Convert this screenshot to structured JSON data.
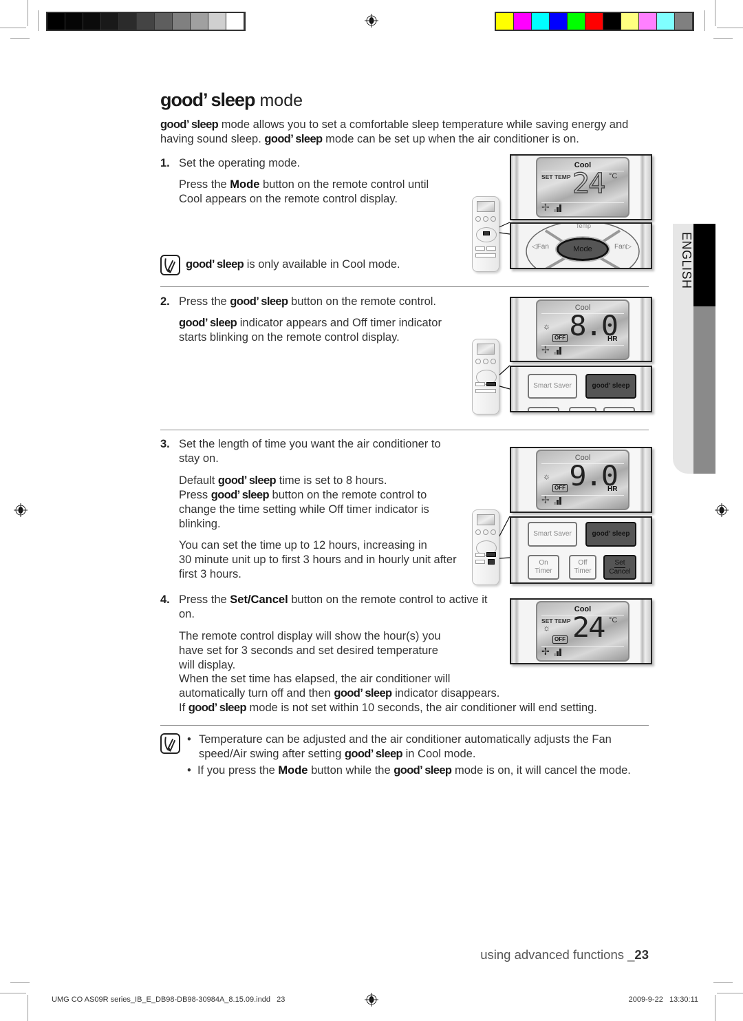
{
  "print_marks": {
    "gray_swatches": [
      "#000000",
      "#050505",
      "#0b0b0b",
      "#191919",
      "#2b2b2b",
      "#444444",
      "#5e5e5e",
      "#808080",
      "#a0a0a0",
      "#d0d0d0",
      "#ffffff"
    ],
    "color_swatches": [
      "#ffff00",
      "#ff00ff",
      "#00ffff",
      "#0000ff",
      "#00ff00",
      "#ff0000",
      "#000000",
      "#ffff80",
      "#ff80ff",
      "#80ffff",
      "#808080"
    ]
  },
  "side_tab": {
    "label": "ENGLISH"
  },
  "title": {
    "brand": "good’ sleep",
    "rest": " mode"
  },
  "intro": [
    [
      {
        "t": "good’ sleep",
        "s": "brand"
      },
      {
        "t": " mode allows you to set a comfortable sleep temperature while saving energy and"
      }
    ],
    [
      {
        "t": "having sound sleep. "
      },
      {
        "t": "good’ sleep",
        "s": "brand"
      },
      {
        "t": " mode can be set up when the air conditioner is on."
      }
    ]
  ],
  "steps": [
    {
      "number": "1.",
      "heading": [
        [
          {
            "t": "Set the operating mode."
          }
        ]
      ],
      "body": [
        [
          {
            "t": "Press the "
          },
          {
            "t": "Mode",
            "s": "b"
          },
          {
            "t": " button on the remote control until"
          }
        ],
        [
          {
            "t": "Cool appears on the remote control display."
          }
        ]
      ],
      "note": [
        [
          {
            "t": "good’ sleep",
            "s": "brand"
          },
          {
            "t": " is only available in Cool mode."
          }
        ]
      ]
    },
    {
      "number": "2.",
      "heading": [
        [
          {
            "t": "Press the "
          },
          {
            "t": "good’ sleep",
            "s": "brand"
          },
          {
            "t": " button on the remote control."
          }
        ]
      ],
      "body": [
        [
          {
            "t": "good’ sleep",
            "s": "brand"
          },
          {
            "t": " indicator appears and Off timer indicator"
          }
        ],
        [
          {
            "t": "starts blinking on the remote control display."
          }
        ]
      ]
    },
    {
      "number": "3.",
      "heading": [
        [
          {
            "t": "Set the length of time you want the air conditioner to"
          }
        ],
        [
          {
            "t": "stay on."
          }
        ]
      ],
      "body_a": [
        [
          {
            "t": "Default "
          },
          {
            "t": "good’ sleep",
            "s": "brand"
          },
          {
            "t": " time is set to 8 hours."
          }
        ]
      ],
      "body_b": [
        [
          {
            "t": "Press "
          },
          {
            "t": "good’ sleep",
            "s": "brand"
          },
          {
            "t": " button on the remote control to"
          }
        ],
        [
          {
            "t": "change the time setting while Off timer indicator is"
          }
        ],
        [
          {
            "t": "blinking."
          }
        ]
      ],
      "body_c": [
        [
          {
            "t": "You can set the time up to 12 hours, increasing in"
          }
        ],
        [
          {
            "t": "30 minute unit up to first 3 hours and in hourly unit after"
          }
        ],
        [
          {
            "t": "first 3 hours."
          }
        ]
      ]
    },
    {
      "number": "4.",
      "heading": [
        [
          {
            "t": "Press the "
          },
          {
            "t": "Set/Cancel",
            "s": "b"
          },
          {
            "t": " button on the remote control to active it"
          }
        ],
        [
          {
            "t": "on."
          }
        ]
      ],
      "body": [
        [
          {
            "t": "The remote control display will show the hour(s) you"
          }
        ],
        [
          {
            "t": "have set for 3 seconds and set desired temperature"
          }
        ],
        [
          {
            "t": "will display."
          }
        ],
        [
          {
            "t": "When the set time has elapsed, the air conditioner will"
          }
        ],
        [
          {
            "t": "automatically turn off and then "
          },
          {
            "t": "good’ sleep",
            "s": "brand"
          },
          {
            "t": " indicator disappears."
          }
        ],
        [
          {
            "t": "If "
          },
          {
            "t": "good’ sleep",
            "s": "brand"
          },
          {
            "t": " mode is not set within 10 seconds, the air conditioner will end setting."
          }
        ]
      ]
    }
  ],
  "notes": {
    "bullet": "•",
    "items": [
      [
        [
          {
            "t": "Temperature can be adjusted and the air conditioner automatically adjusts the Fan"
          }
        ],
        [
          {
            "t": "speed/Air swing after setting "
          },
          {
            "t": "good’ sleep",
            "s": "brand"
          },
          {
            "t": " in Cool mode."
          }
        ]
      ],
      [
        [
          {
            "t": "If you press the "
          },
          {
            "t": "Mode",
            "s": "b"
          },
          {
            "t": " button while the "
          },
          {
            "t": "good’ sleep",
            "s": "brand"
          },
          {
            "t": " mode is on, it will cancel the mode."
          }
        ]
      ]
    ]
  },
  "displays": {
    "mode": "Cool",
    "set_temp": "SET TEMP",
    "temp": "24",
    "temp_unit": "°C",
    "off": "OFF",
    "hr": "HR",
    "timer_default": "8.0",
    "timer_changed": "9.0"
  },
  "buttons": {
    "mode": "Mode",
    "fan_left": "◁Fan",
    "fan_right": "Fan▷",
    "temp": "Temp",
    "smart_saver": "Smart Saver",
    "good_sleep": "good’ sleep",
    "on_timer": "On\nTimer",
    "off_timer": "Off\nTimer",
    "set": "Set",
    "cancel": "Cancel"
  },
  "footer": {
    "section": "using advanced functions _",
    "page": "23",
    "slug_file": "UMG CO AS09R series_IB_E_DB98-DB98-30984A_8.15.09.indd   23",
    "slug_date": "2009-9-22   13:30:11"
  }
}
